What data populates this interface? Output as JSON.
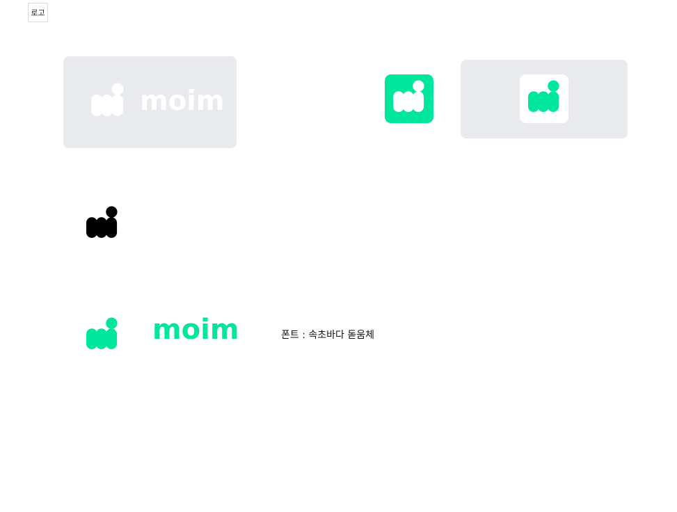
{
  "header": {
    "tab_label": "로고"
  },
  "colors": {
    "brand_green": "#00e79d",
    "panel_gray": "#e8eaed",
    "white": "#ffffff",
    "black": "#000000"
  },
  "logo": {
    "wordmark": "moim"
  },
  "font_note": "폰트 : 속초바다 돋움체",
  "icons": [
    "moim-logo-mark-icon"
  ]
}
